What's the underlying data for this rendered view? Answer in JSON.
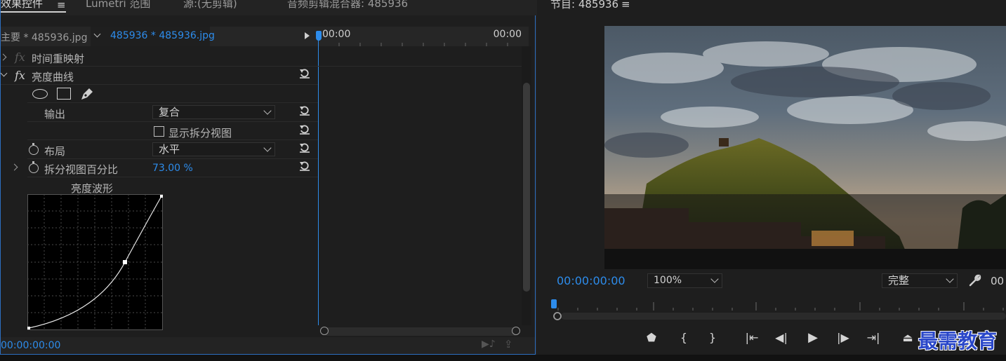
{
  "tabs": [
    {
      "label": "效果控件",
      "active": true
    },
    {
      "label": "Lumetri 范围",
      "active": false
    },
    {
      "label": "源:(无剪辑)",
      "active": false
    },
    {
      "label": "音频剪辑混合器: 485936",
      "active": false
    }
  ],
  "tab_menu_icon": "hamburger-icon",
  "clip_header": {
    "master_clip": "主要 * 485936.jpg",
    "sequence_clip": "485936 * 485936.jpg"
  },
  "timeline_ruler": {
    "start": "00:00",
    "end": "00:00"
  },
  "effects": [
    {
      "name": "时间重映射",
      "fx_enabled": false,
      "expanded": false
    },
    {
      "name": "亮度曲线",
      "fx_enabled": true,
      "expanded": true
    }
  ],
  "mask_tools": [
    "ellipse-mask-icon",
    "rectangle-mask-icon",
    "pen-mask-icon"
  ],
  "properties": {
    "output_label": "输出",
    "output_value": "复合",
    "show_split_label": "显示拆分视图",
    "show_split_checked": false,
    "layout_label": "布局",
    "layout_value": "水平",
    "split_percent_label": "拆分视图百分比",
    "split_percent_value": "73.00",
    "split_percent_unit": "%"
  },
  "curve": {
    "title": "亮度波形",
    "control_point": [
      0.72,
      0.5
    ]
  },
  "effects_timecode": "00:00:00:00",
  "program": {
    "title": "节目: 485936",
    "timecode": "00:00:00:00",
    "zoom": "100%",
    "quality": "完整",
    "end_timecode": "00",
    "wrench_icon": "wrench-icon"
  },
  "transport_icons": [
    "add-marker-icon",
    "mark-in-icon",
    "mark-out-icon",
    "go-to-in-icon",
    "step-back-icon",
    "play-icon",
    "step-forward-icon",
    "go-to-out-icon",
    "lift-icon"
  ],
  "watermark": "最需教育",
  "colors": {
    "accent": "#2d8ceb",
    "panel": "#1e1e1e",
    "border": "#2d6fc1"
  }
}
